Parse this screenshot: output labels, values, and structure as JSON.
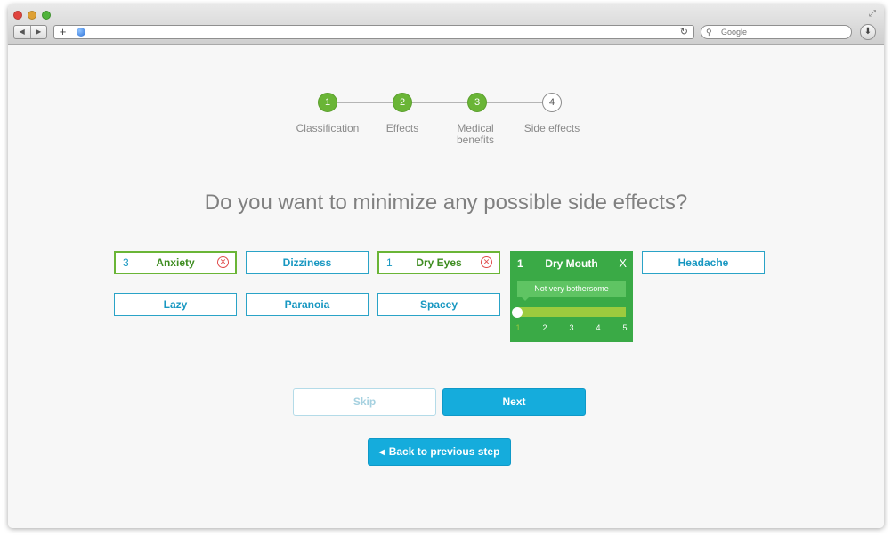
{
  "browser": {
    "back_glyph": "◀",
    "forward_glyph": "▶",
    "new_tab_glyph": "+",
    "reload_glyph": "↻",
    "search_placeholder": "Google",
    "search_glyph": "⚲",
    "download_glyph": "⬇",
    "resize_glyph": "⤢"
  },
  "stepper": {
    "steps": [
      {
        "number": "1",
        "label": "Classification",
        "state": "done"
      },
      {
        "number": "2",
        "label": "Effects",
        "state": "done"
      },
      {
        "number": "3",
        "label": "Medical benefits",
        "state": "done"
      },
      {
        "number": "4",
        "label": "Side effects",
        "state": "current"
      }
    ]
  },
  "question": "Do you want to minimize any possible side effects?",
  "options": {
    "anxiety": {
      "label": "Anxiety",
      "rank": "3",
      "selected": true,
      "remove_glyph": "✕"
    },
    "dizziness": {
      "label": "Dizziness",
      "selected": false
    },
    "dry_eyes": {
      "label": "Dry Eyes",
      "rank": "1",
      "selected": true,
      "remove_glyph": "✕"
    },
    "dry_mouth": {
      "label": "Dry Mouth",
      "rank": "1",
      "close_glyph": "X",
      "tooltip": "Not very bothersome",
      "scale": [
        "1",
        "2",
        "3",
        "4",
        "5"
      ],
      "value": 1
    },
    "headache": {
      "label": "Headache",
      "selected": false
    },
    "lazy": {
      "label": "Lazy",
      "selected": false
    },
    "paranoia": {
      "label": "Paranoia",
      "selected": false
    },
    "spacey": {
      "label": "Spacey",
      "selected": false
    }
  },
  "actions": {
    "skip_label": "Skip",
    "next_label": "Next",
    "back_label": "Back to previous step",
    "back_glyph": "◀"
  },
  "colors": {
    "accent_blue": "#15acdc",
    "selected_green": "#6ab536",
    "panel_green": "#3aaa46",
    "remove_red": "#e04b4b"
  }
}
